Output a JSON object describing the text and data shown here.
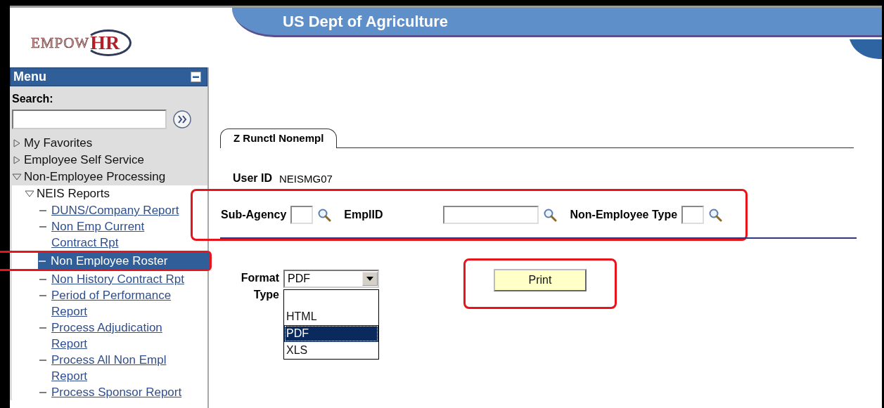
{
  "logo": {
    "text": "EMPOW",
    "accent": "HR"
  },
  "banner": {
    "title": "US Dept of Agriculture"
  },
  "menu": {
    "title": "Menu",
    "search_label": "Search:",
    "items": [
      {
        "label": "My Favorites",
        "expanded": false
      },
      {
        "label": "Employee Self Service",
        "expanded": false
      },
      {
        "label": "Non-Employee Processing",
        "expanded": true,
        "children": [
          {
            "label": "NEIS Reports",
            "expanded": true,
            "children": [
              {
                "label": "DUNS/Company Report",
                "selected": false,
                "highlighted": false
              },
              {
                "label": "Non Emp Current Contract Rpt",
                "selected": false,
                "highlighted": false
              },
              {
                "label": "Non Employee Roster",
                "selected": true,
                "highlighted": true
              },
              {
                "label": "Non History Contract Rpt",
                "selected": false,
                "highlighted": false
              },
              {
                "label": "Period of Performance Report",
                "selected": false,
                "highlighted": false
              },
              {
                "label": "Process Adjudication Report",
                "selected": false,
                "highlighted": false
              },
              {
                "label": "Process All Non Empl Report",
                "selected": false,
                "highlighted": false
              },
              {
                "label": "Process Sponsor Report",
                "selected": false,
                "highlighted": false
              }
            ]
          }
        ]
      }
    ]
  },
  "tab": {
    "label": "Z Runctl Nonempl",
    "selected": true
  },
  "user_id": {
    "label": "User ID",
    "value": "NEISMG07"
  },
  "criteria": {
    "highlighted": true,
    "fields": [
      {
        "label": "Sub-Agency"
      },
      {
        "label": "EmplID"
      },
      {
        "label": "Non-Employee Type"
      }
    ]
  },
  "format": {
    "label": "Format Type",
    "value": "PDF",
    "open": true,
    "options": [
      {
        "label": "HTML",
        "selected": false
      },
      {
        "label": "PDF",
        "selected": true
      },
      {
        "label": "XLS",
        "selected": false
      }
    ]
  },
  "print": {
    "label": "Print",
    "highlighted": true
  }
}
